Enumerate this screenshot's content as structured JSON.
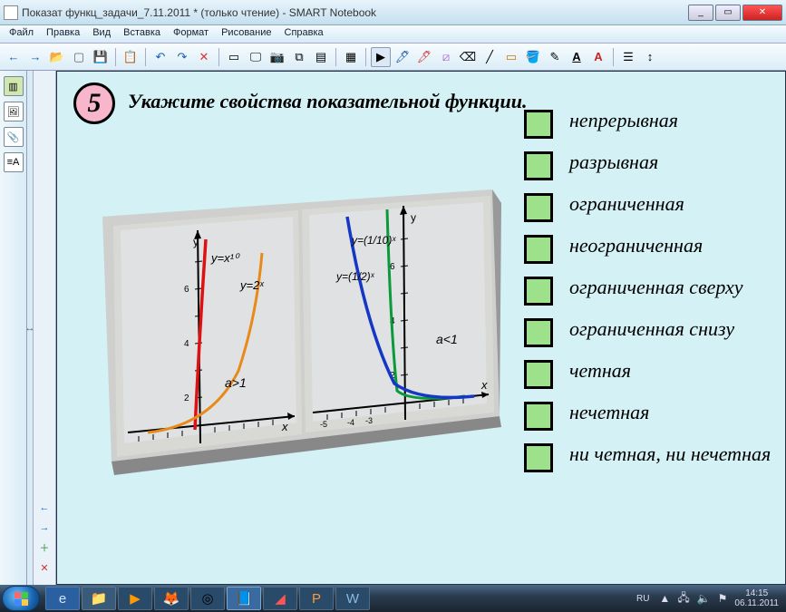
{
  "window": {
    "title": "Показат функц_задачи_7.11.2011 * (только чтение) - SMART Notebook",
    "min": "_",
    "max": "▭",
    "close": "✕"
  },
  "menu": [
    "Файл",
    "Правка",
    "Вид",
    "Вставка",
    "Формат",
    "Рисование",
    "Справка"
  ],
  "toolbar": {
    "back": "←",
    "fwd": "→",
    "open": "📂",
    "new": "▢",
    "save": "💾",
    "paste": "📋",
    "undo": "↶",
    "redo": "↷",
    "delete": "✕",
    "screen": "▭",
    "capture": "🖵",
    "doccam": "📷",
    "dual": "⧉",
    "shade": "▤",
    "table": "▦",
    "select": "▶",
    "pen1": "🖊",
    "pen2": "🖊",
    "hl": "⧄",
    "eraser": "⌫",
    "line": "╱",
    "shape": "▭",
    "fill": "🪣",
    "magic": "✎",
    "text": "A",
    "color": "A",
    "props": "☰",
    "move": "↕"
  },
  "sidebar": {
    "t1": "▥",
    "t2": "🖼",
    "t3": "📎",
    "t4": "≡A",
    "splitter": "↔"
  },
  "slide_nav": {
    "prev": "←",
    "next": "→",
    "add": "＋",
    "del": "✕"
  },
  "slide": {
    "number": "5",
    "question": "Укажите свойства показательной функции.",
    "answers": [
      "непрерывная",
      "разрывная",
      "ограниченная",
      "неограниченная",
      "ограниченная сверху",
      "ограниченная снизу",
      "четная",
      "нечетная",
      "ни четная, ни нечетная"
    ],
    "graph": {
      "left": {
        "title_y": "y",
        "f1": "y=x¹⁰",
        "f2": "y=2ˣ",
        "cond": "a>1",
        "xlabel": "x"
      },
      "right": {
        "title_y": "y",
        "f1": "y=(1/10)ˣ",
        "f2": "y=(1/2)ˣ",
        "cond": "a<1",
        "xlabel": "x"
      }
    }
  },
  "taskbar": {
    "icons": [
      {
        "bg": "#2a5fa0",
        "glyph": "e"
      },
      {
        "bg": "#c9a85b",
        "glyph": "📁"
      },
      {
        "bg": "#3a8fd0",
        "glyph": "▶"
      },
      {
        "bg": "#d07820",
        "glyph": "🦊"
      },
      {
        "bg": "#c9b04a",
        "glyph": "◎"
      },
      {
        "bg": "#4a8fc0",
        "glyph": "📘"
      },
      {
        "bg": "#a02b2b",
        "glyph": "◢"
      },
      {
        "bg": "#c75b2b",
        "glyph": "P"
      },
      {
        "bg": "#3a6fc0",
        "glyph": "W"
      }
    ],
    "lang": "RU",
    "flag": "▲",
    "net": "🖧",
    "snd": "🔈",
    "flag2": "⚑",
    "time": "14:15",
    "date": "06.11.2011"
  },
  "chart_data": [
    {
      "type": "line",
      "title": "a>1",
      "xlabel": "x",
      "ylabel": "y",
      "xlim": [
        -5,
        5
      ],
      "ylim": [
        -1,
        7
      ],
      "series": [
        {
          "name": "y=x^10",
          "values": [
            [
              -1,
              1
            ],
            [
              0,
              0
            ],
            [
              0.5,
              0.001
            ],
            [
              0.8,
              0.11
            ],
            [
              1,
              1
            ],
            [
              1.1,
              2.6
            ],
            [
              1.2,
              6.2
            ]
          ]
        },
        {
          "name": "y=2^x",
          "values": [
            [
              -4,
              0.06
            ],
            [
              -2,
              0.25
            ],
            [
              0,
              1
            ],
            [
              1,
              2
            ],
            [
              2,
              4
            ],
            [
              2.7,
              6.5
            ]
          ]
        }
      ]
    },
    {
      "type": "line",
      "title": "a<1",
      "xlabel": "x",
      "ylabel": "y",
      "xlim": [
        -5,
        5
      ],
      "ylim": [
        -1,
        7
      ],
      "series": [
        {
          "name": "y=(1/10)^x",
          "values": [
            [
              -0.85,
              7
            ],
            [
              -0.5,
              3.2
            ],
            [
              0,
              1
            ],
            [
              1,
              0.1
            ],
            [
              2,
              0.01
            ]
          ]
        },
        {
          "name": "y=(1/2)^x",
          "values": [
            [
              -2.8,
              7
            ],
            [
              -2,
              4
            ],
            [
              -1,
              2
            ],
            [
              0,
              1
            ],
            [
              2,
              0.25
            ],
            [
              4,
              0.06
            ]
          ]
        }
      ]
    }
  ]
}
